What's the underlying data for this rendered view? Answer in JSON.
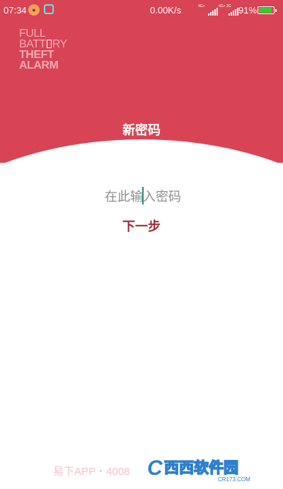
{
  "status_bar": {
    "time": "07:34",
    "network_speed": "0.00K/s",
    "signal1_tag": "4G+",
    "signal2_tag": "4G+ 2G",
    "battery_percent": "91%",
    "battery_level": 0.91
  },
  "logo": {
    "line1": "FULL",
    "line2a": "BATT",
    "line2b": "RY",
    "line3": "THEFT",
    "line4": "ALARM"
  },
  "header": {
    "title": "新密码"
  },
  "form": {
    "password_placeholder": "在此输入密码",
    "password_value": "",
    "next_label": "下一步"
  },
  "watermark": {
    "footer_text": "易下APP・4008",
    "corner_text": "西西软件园",
    "corner_subtext": "CR173.COM"
  },
  "colors": {
    "header_bg": "#d84455",
    "next_button": "#a02a3b",
    "caret": "#1f8c87"
  }
}
